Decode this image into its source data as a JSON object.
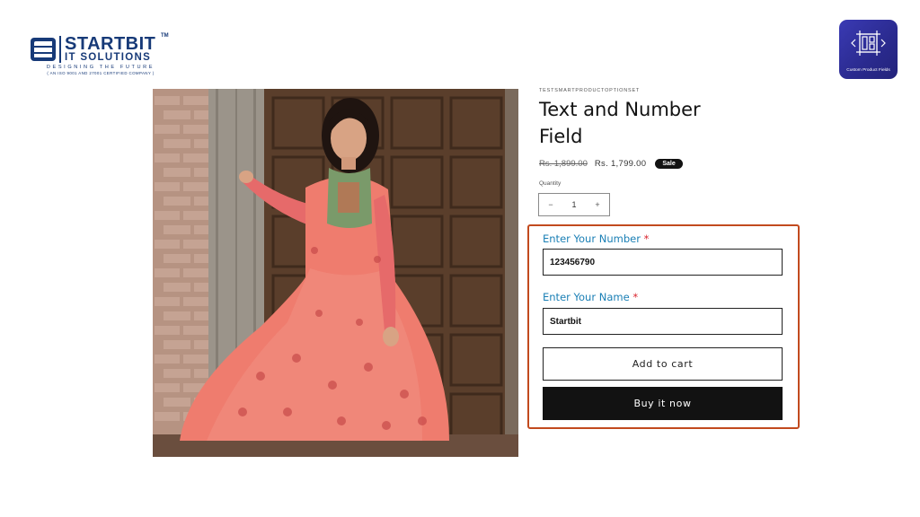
{
  "brand": {
    "name": "STARTBIT",
    "tm": "TM",
    "subtitle": "IT SOLUTIONS",
    "tagline": "DESIGNING THE FUTURE",
    "certification": "( AN ISO 9001 AND 27001 CERTIFIED COMPANY )",
    "color": "#173a78"
  },
  "app_badge": {
    "label": "Custom Product Fields",
    "icon": "layout-grid-icon",
    "color": "#2f2f9c"
  },
  "product": {
    "vendor": "TESTSMARTPRODUCTOPTIONSET",
    "title": "Text and Number Field",
    "price_regular": "Rs. 1,899.00",
    "price_sale": "Rs. 1,799.00",
    "sale_badge": "Sale",
    "image_alt": "woman in pink floral printed anarkali dress"
  },
  "quantity": {
    "label": "Quantity",
    "value": "1",
    "minus": "−",
    "plus": "+"
  },
  "custom_fields": [
    {
      "label": "Enter Your Number",
      "required_mark": "*",
      "value": "123456790"
    },
    {
      "label": "Enter Your Name",
      "required_mark": "*",
      "value": "Startbit"
    }
  ],
  "actions": {
    "add_to_cart": "Add to cart",
    "buy_now": "Buy it now"
  },
  "colors": {
    "highlight_border": "#c24a1e",
    "field_label": "#1a7fb5",
    "required": "#d9232d"
  }
}
